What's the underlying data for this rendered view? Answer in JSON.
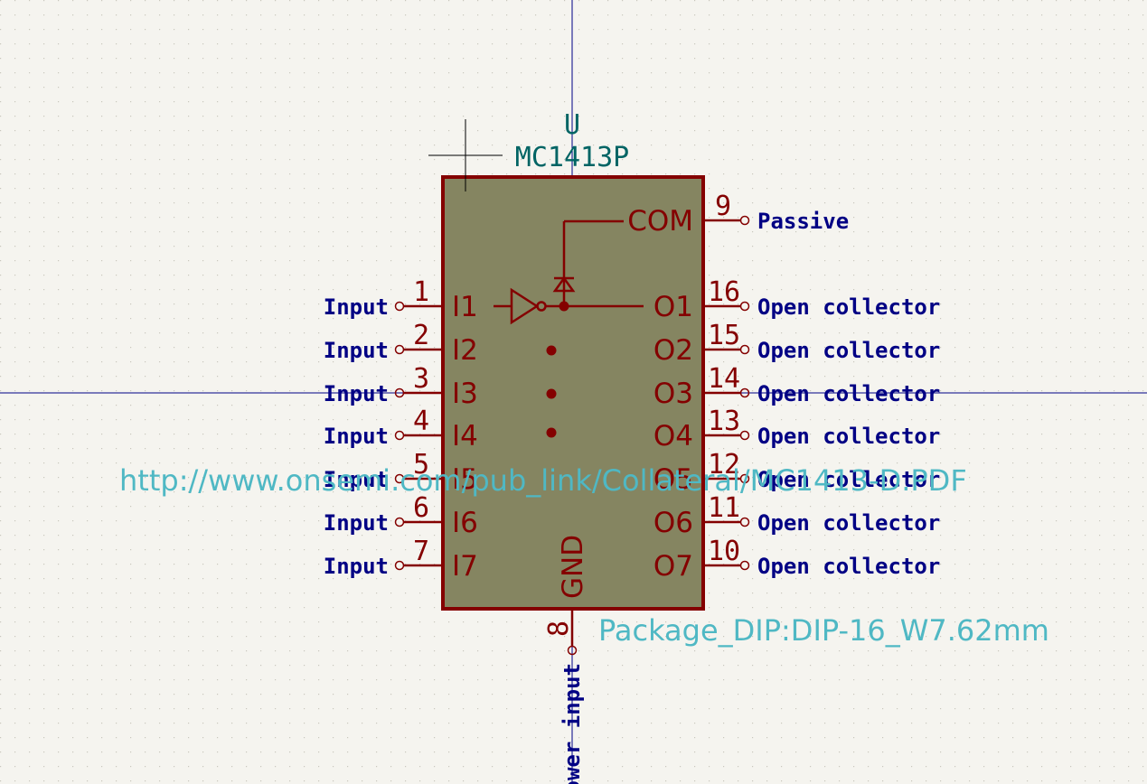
{
  "symbol": {
    "reference": "U",
    "value": "MC1413P",
    "footprint": "Package_DIP:DIP-16_W7.62mm",
    "datasheet": "http://www.onsemi.com/pub_link/Collateral/MC1413-D.PDF"
  },
  "left_pins": [
    {
      "number": "1",
      "name": "I1",
      "etype": "Input"
    },
    {
      "number": "2",
      "name": "I2",
      "etype": "Input"
    },
    {
      "number": "3",
      "name": "I3",
      "etype": "Input"
    },
    {
      "number": "4",
      "name": "I4",
      "etype": "Input"
    },
    {
      "number": "5",
      "name": "I5",
      "etype": "Input"
    },
    {
      "number": "6",
      "name": "I6",
      "etype": "Input"
    },
    {
      "number": "7",
      "name": "I7",
      "etype": "Input"
    }
  ],
  "right_pins": [
    {
      "number": "16",
      "name": "O1",
      "etype": "Open collector"
    },
    {
      "number": "15",
      "name": "O2",
      "etype": "Open collector"
    },
    {
      "number": "14",
      "name": "O3",
      "etype": "Open collector"
    },
    {
      "number": "13",
      "name": "O4",
      "etype": "Open collector"
    },
    {
      "number": "12",
      "name": "O5",
      "etype": "Open collector"
    },
    {
      "number": "11",
      "name": "O6",
      "etype": "Open collector"
    },
    {
      "number": "10",
      "name": "O7",
      "etype": "Open collector"
    }
  ],
  "com_pin": {
    "number": "9",
    "name": "COM",
    "etype": "Passive"
  },
  "gnd_pin": {
    "number": "8",
    "name": "GND",
    "etype": "Power input"
  },
  "colors": {
    "background": "#f5f4ef",
    "body_fill": "#858561",
    "body_outline": "#840000",
    "pin": "#840000",
    "crosshair": "#000084",
    "reference_text": "#006464",
    "field_text": "#4fb8c4",
    "etype_text": "#000084"
  }
}
